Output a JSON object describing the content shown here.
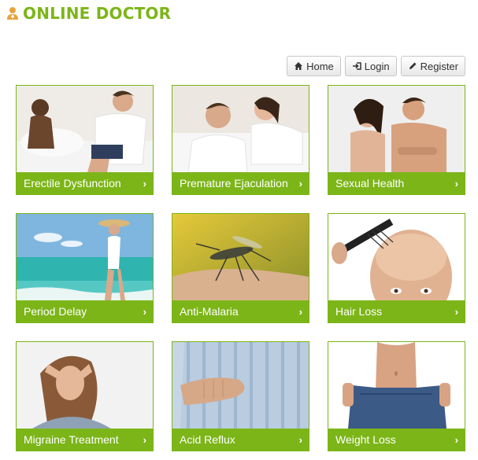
{
  "header": {
    "brand": "ONLINE DOCTOR",
    "brand_color": "#7cb518",
    "logo_icon": "doctor-icon"
  },
  "nav": {
    "home": {
      "label": "Home",
      "icon": "home-icon"
    },
    "login": {
      "label": "Login",
      "icon": "login-icon"
    },
    "register": {
      "label": "Register",
      "icon": "pencil-icon"
    }
  },
  "services": [
    {
      "label": "Erectile Dysfunction"
    },
    {
      "label": "Premature Ejaculation"
    },
    {
      "label": "Sexual Health"
    },
    {
      "label": "Period Delay"
    },
    {
      "label": "Anti-Malaria"
    },
    {
      "label": "Hair Loss"
    },
    {
      "label": "Migraine Treatment"
    },
    {
      "label": "Acid Reflux"
    },
    {
      "label": "Weight Loss"
    }
  ],
  "chevron": "›"
}
